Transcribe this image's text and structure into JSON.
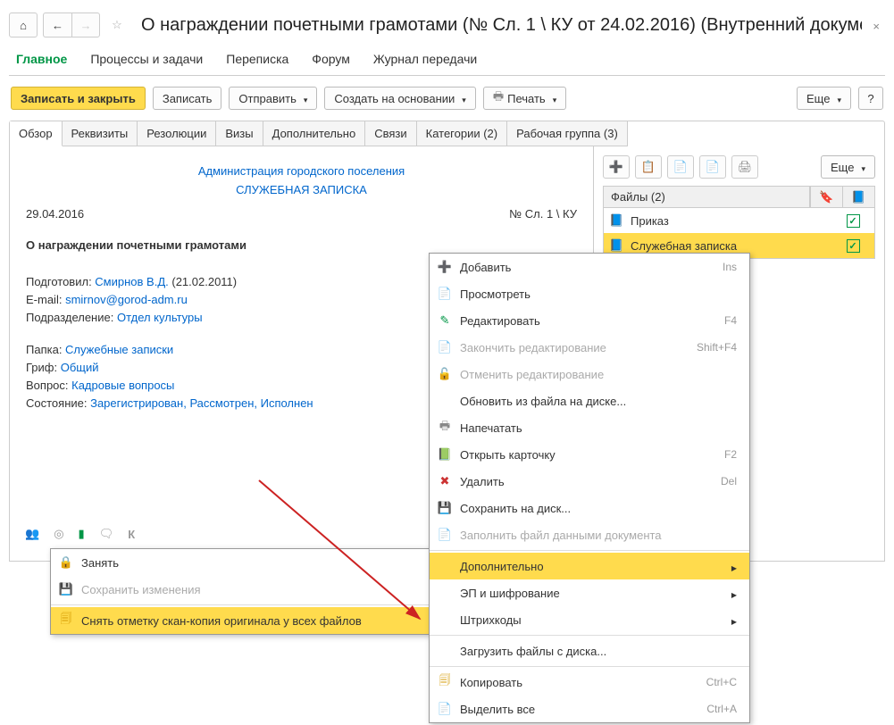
{
  "header": {
    "title": "О награждении почетными грамотами (№ Сл. 1 \\ КУ от 24.02.2016) (Внутренний докуме..."
  },
  "mainTabs": {
    "t0": "Главное",
    "t1": "Процессы и задачи",
    "t2": "Переписка",
    "t3": "Форум",
    "t4": "Журнал передачи"
  },
  "toolbar": {
    "saveClose": "Записать и закрыть",
    "save": "Записать",
    "send": "Отправить",
    "createBased": "Создать на основании",
    "print": "Печать",
    "more": "Еще",
    "help": "?"
  },
  "subTabs": {
    "t0": "Обзор",
    "t1": "Реквизиты",
    "t2": "Резолюции",
    "t3": "Визы",
    "t4": "Дополнительно",
    "t5": "Связи",
    "t6": "Категории (2)",
    "t7": "Рабочая группа (3)"
  },
  "doc": {
    "orgLink": "Администрация городского поселения",
    "docTypeLink": "СЛУЖЕБНАЯ ЗАПИСКА",
    "date": "29.04.2016",
    "regNum": "№ Сл. 1 \\ КУ",
    "subject": "О награждении почетными грамотами",
    "preparedByLabel": "Подготовил: ",
    "preparedBy": "Смирнов В.Д.",
    "preparedDate": " (21.02.2011)",
    "emailLabel": "E-mail: ",
    "email": "smirnov@gorod-adm.ru",
    "deptLabel": "Подразделение: ",
    "dept": "Отдел культуры",
    "folderLabel": "Папка: ",
    "folder": "Служебные записки",
    "grifLabel": "Гриф: ",
    "grif": "Общий",
    "questionLabel": "Вопрос: ",
    "question": "Кадровые вопросы",
    "stateLabel": "Состояние: ",
    "state": "Зарегистрирован, Рассмотрен, Исполнен"
  },
  "files": {
    "header": "Файлы (2)",
    "more": "Еще",
    "r0": "Приказ",
    "r1": "Служебная записка"
  },
  "bottomBar": {
    "letterK": "К"
  },
  "smallMenu": {
    "i0": "Занять",
    "i1": "Сохранить изменения",
    "i2": "Снять отметку скан-копия оригинала у всех файлов"
  },
  "bigMenu": {
    "add": "Добавить",
    "addSc": "Ins",
    "view": "Просмотреть",
    "edit": "Редактировать",
    "editSc": "F4",
    "finishEdit": "Закончить редактирование",
    "finishEditSc": "Shift+F4",
    "cancelEdit": "Отменить редактирование",
    "updateFile": "Обновить из файла на диске...",
    "print": "Напечатать",
    "openCard": "Открыть карточку",
    "openCardSc": "F2",
    "delete": "Удалить",
    "deleteSc": "Del",
    "saveDisk": "Сохранить на диск...",
    "fillFile": "Заполнить файл данными документа",
    "more": "Дополнительно",
    "sign": "ЭП и шифрование",
    "barcodes": "Штрихкоды",
    "loadDisk": "Загрузить файлы с диска...",
    "copy": "Копировать",
    "copySc": "Ctrl+C",
    "selectAll": "Выделить все",
    "selectAllSc": "Ctrl+A"
  }
}
